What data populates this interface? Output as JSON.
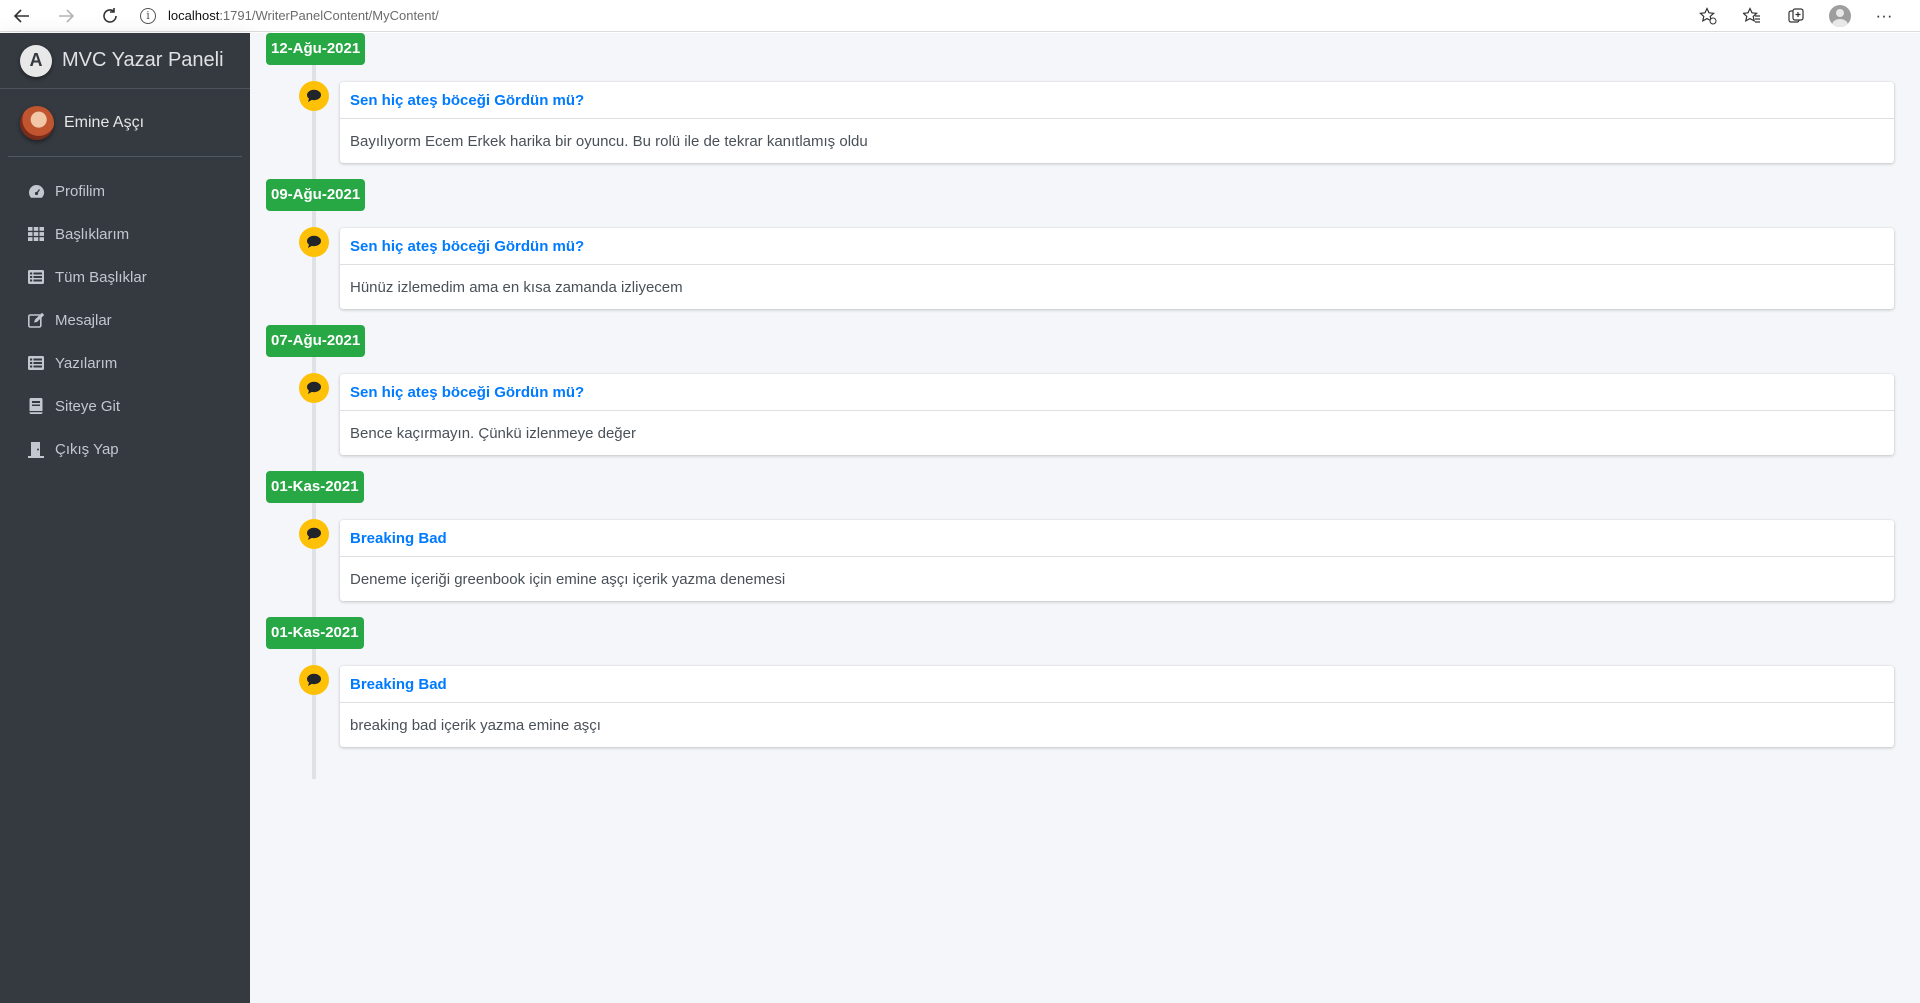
{
  "browser": {
    "url_host": "localhost",
    "url_path": ":1791/WriterPanelContent/MyContent/"
  },
  "sidebar": {
    "brand": "MVC Yazar Paneli",
    "brand_logo_letter": "A",
    "user_name": "Emine Aşçı",
    "items": [
      {
        "label": "Profilim",
        "icon": "dashboard-icon"
      },
      {
        "label": "Başlıklarım",
        "icon": "grid-icon"
      },
      {
        "label": "Tüm Başlıklar",
        "icon": "list-icon"
      },
      {
        "label": "Mesajlar",
        "icon": "edit-icon"
      },
      {
        "label": "Yazılarım",
        "icon": "list-icon"
      },
      {
        "label": "Siteye Git",
        "icon": "book-icon"
      },
      {
        "label": "Çıkış Yap",
        "icon": "door-icon"
      }
    ]
  },
  "timeline": [
    {
      "date": "12-Ağu-2021",
      "title": "Sen hiç ateş böceği Gördün mü?",
      "text": "Bayılıyorm Ecem Erkek harika bir oyuncu. Bu rolü ile de tekrar kanıtlamış oldu"
    },
    {
      "date": "09-Ağu-2021",
      "title": "Sen hiç ateş böceği Gördün mü?",
      "text": "Hünüz izlemedim ama en kısa zamanda izliyecem"
    },
    {
      "date": "07-Ağu-2021",
      "title": "Sen hiç ateş böceği Gördün mü?",
      "text": "Bence kaçırmayın. Çünkü izlenmeye değer"
    },
    {
      "date": "01-Kas-2021",
      "title": "Breaking Bad",
      "text": "Deneme içeriği greenbook için emine aşçı içerik yazma denemesi"
    },
    {
      "date": "01-Kas-2021",
      "title": "Breaking Bad",
      "text": "breaking bad içerik yazma emine aşçı"
    }
  ],
  "colors": {
    "sidebar_bg": "#343a40",
    "content_bg": "#f4f6f9",
    "date_badge": "#28a745",
    "comment_bubble": "#ffc107",
    "link": "#007bff"
  }
}
